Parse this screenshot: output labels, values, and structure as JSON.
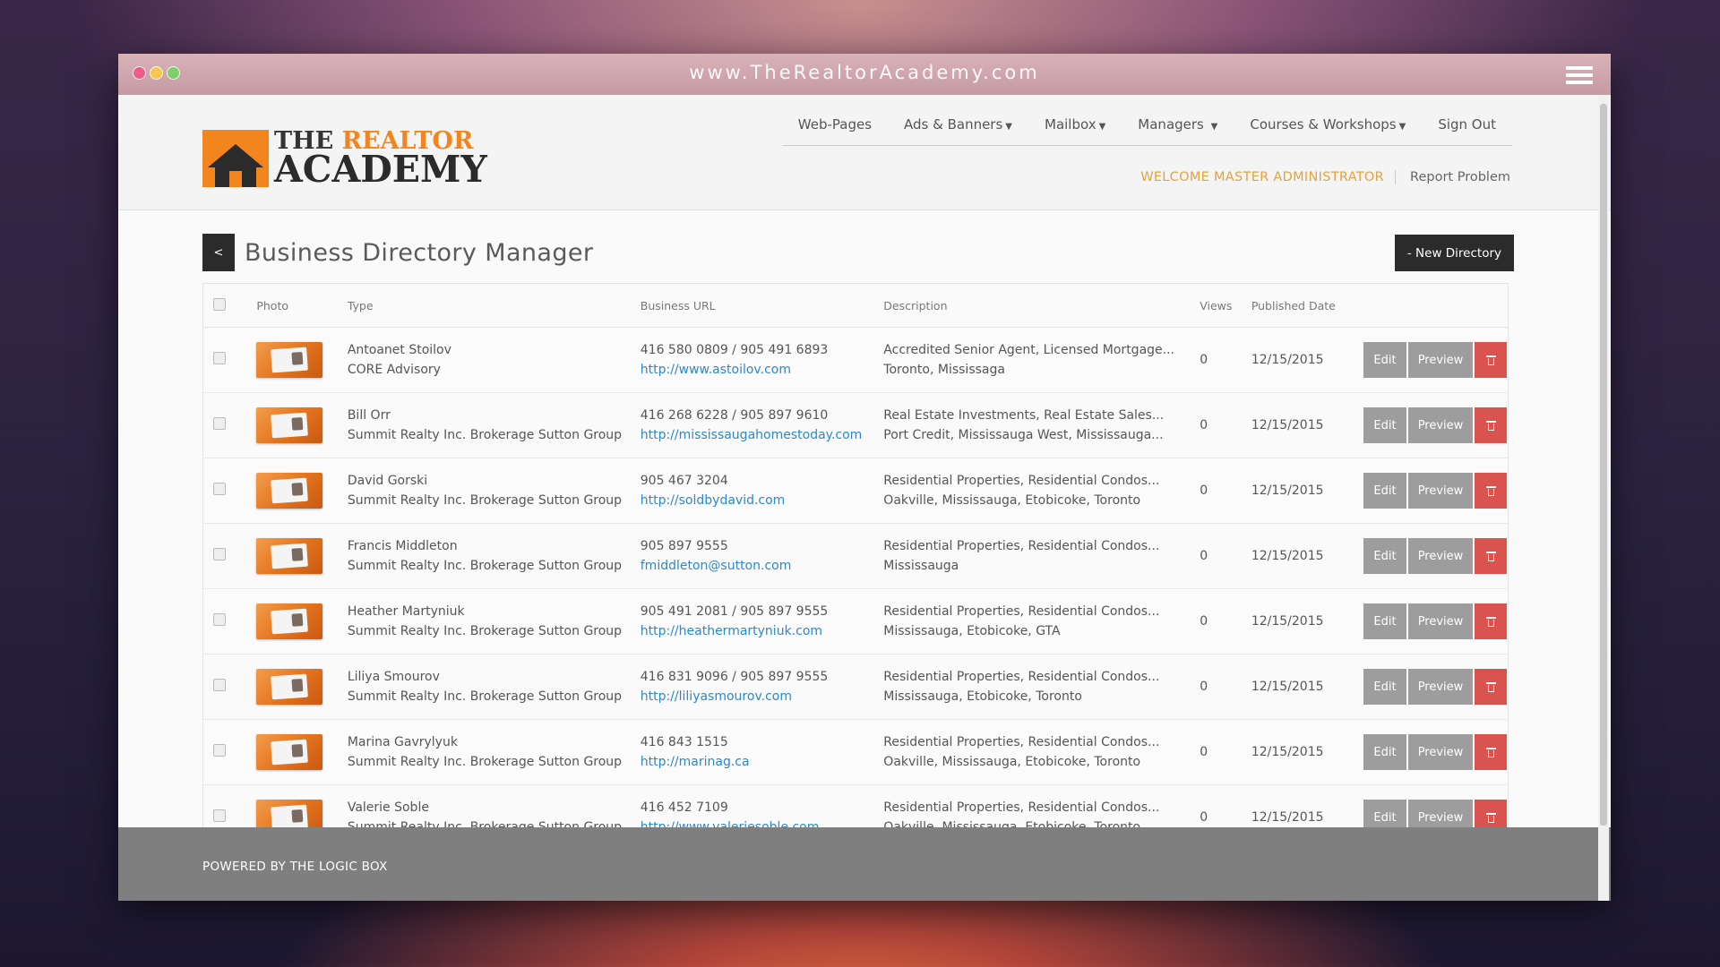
{
  "browser": {
    "url": "www.TheRealtorAcademy.com"
  },
  "logo": {
    "line1a": "THE ",
    "line1b": "REALTOR",
    "line2": "ACADEMY"
  },
  "nav": {
    "items": [
      {
        "label": "Web-Pages",
        "dropdown": false
      },
      {
        "label": "Ads & Banners",
        "dropdown": true
      },
      {
        "label": "Mailbox",
        "dropdown": true
      },
      {
        "label": "Managers",
        "dropdown": true
      },
      {
        "label": "Courses & Workshops",
        "dropdown": true
      },
      {
        "label": "Sign Out",
        "dropdown": false
      }
    ],
    "welcome": "WELCOME MASTER ADMINISTRATOR",
    "report": "Report Problem"
  },
  "page": {
    "back_label": "<",
    "title": "Business Directory Manager",
    "new_button": "- New Directory"
  },
  "table": {
    "headers": [
      "Photo",
      "Type",
      "Business URL",
      "Description",
      "Views",
      "Published Date"
    ],
    "rows": [
      {
        "name": "Antoanet Stoilov",
        "company": "CORE Advisory",
        "phone": "416 580 0809 / 905 491 6893",
        "url": "http://www.astoilov.com",
        "desc1": "Accredited Senior Agent, Licensed Mortgage...",
        "desc2": "Toronto, Mississaga",
        "views": "0",
        "date": "12/15/2015"
      },
      {
        "name": "Bill Orr",
        "company": "Summit Realty Inc. Brokerage Sutton Group",
        "phone": "416 268 6228 / 905 897 9610",
        "url": "http://mississaugahomestoday.com",
        "desc1": "Real Estate Investments, Real Estate Sales...",
        "desc2": "Port Credit, Mississauga West, Mississauga...",
        "views": "0",
        "date": "12/15/2015"
      },
      {
        "name": "David Gorski",
        "company": "Summit Realty Inc. Brokerage Sutton Group",
        "phone": "905 467 3204",
        "url": "http://soldbydavid.com",
        "desc1": "Residential Properties, Residential Condos...",
        "desc2": "Oakville, Mississauga, Etobicoke, Toronto",
        "views": "0",
        "date": "12/15/2015"
      },
      {
        "name": "Francis Middleton",
        "company": "Summit Realty Inc. Brokerage Sutton Group",
        "phone": "905 897 9555",
        "url": "fmiddleton@sutton.com",
        "desc1": "Residential Properties, Residential Condos...",
        "desc2": "Mississauga",
        "views": "0",
        "date": "12/15/2015"
      },
      {
        "name": "Heather Martyniuk",
        "company": "Summit Realty Inc. Brokerage Sutton Group",
        "phone": "905 491 2081 / 905 897 9555",
        "url": "http://heathermartyniuk.com",
        "desc1": "Residential Properties, Residential Condos...",
        "desc2": "Mississauga, Etobicoke, GTA",
        "views": "0",
        "date": "12/15/2015"
      },
      {
        "name": "Liliya Smourov",
        "company": "Summit Realty Inc. Brokerage Sutton Group",
        "phone": "416 831 9096 / 905 897 9555",
        "url": "http://liliyasmourov.com",
        "desc1": "Residential Properties, Residential Condos...",
        "desc2": "Mississauga, Etobicoke, Toronto",
        "views": "0",
        "date": "12/15/2015"
      },
      {
        "name": "Marina Gavrylyuk",
        "company": "Summit Realty Inc. Brokerage Sutton Group",
        "phone": "416 843 1515",
        "url": "http://marinag.ca",
        "desc1": "Residential Properties, Residential Condos...",
        "desc2": "Oakville, Mississauga, Etobicoke, Toronto",
        "views": "0",
        "date": "12/15/2015"
      },
      {
        "name": "Valerie Soble",
        "company": "Summit Realty Inc. Brokerage Sutton Group",
        "phone": "416 452 7109",
        "url": "http://www.valeriesoble.com",
        "desc1": "Residential Properties, Residential Condos...",
        "desc2": "Oakville, Mississauga, Etobicoke, Toronto",
        "views": "0",
        "date": "12/15/2015"
      }
    ],
    "actions": {
      "edit": "Edit",
      "preview": "Preview",
      "delete_icon": "trash-icon"
    }
  },
  "footer": {
    "text": "POWERED BY THE LOGIC BOX"
  },
  "colors": {
    "accent": "#f2851e",
    "danger": "#d9534f",
    "link": "#2d88c9",
    "dark": "#2b2b2b"
  }
}
